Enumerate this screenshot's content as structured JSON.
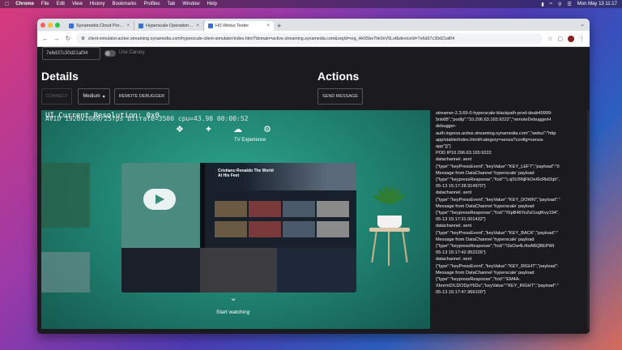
{
  "menubar": {
    "app": "Chrome",
    "items": [
      "File",
      "Edit",
      "View",
      "History",
      "Bookmarks",
      "Profiles",
      "Tab",
      "Window",
      "Help"
    ],
    "datetime": "Mon May 13  11:17"
  },
  "tabs": [
    {
      "label": "Synamedia Cloud Portal | Ho...",
      "active": false
    },
    {
      "label": "Hyperscale Operations UI",
      "active": false
    },
    {
      "label": "HS Webui Tester",
      "active": true
    }
  ],
  "address": {
    "url": "client-simulator.active.streaming.synamedia.com/hyperscale-client-simulator/index.html?domain=active.streaming.synamedia.com&orgId=org_Hk9Ske7hk0oV5Lof&deviceId=7e6d37c30d21af04"
  },
  "page": {
    "device_id": "7e6d37c30d21af04",
    "canary_label": "Use Canary",
    "details_heading": "Details",
    "actions_heading": "Actions",
    "connect_label": "CONNECT",
    "quality_value": "Medium",
    "remote_debugger_label": "REMOTE DEBUGGER",
    "send_message_label": "SEND MESSAGE"
  },
  "stream": {
    "osd_stats": "AVID 1920x1080/25fps bitrate=3500 cpu=43.98 00:00:52",
    "osd_resolution": "UI Current Resolution: 0x0",
    "tv_experience": "TV Experience",
    "start_watching": "Start watching",
    "hero_title": "Cristiano Ronaldo The World At His Feet"
  },
  "log_lines": [
    "streamer-2.3.69-0-hyperscale-blackpath-prod-deub49999-",
    "5nk6B\",\"podIp\":\"10.206.63.165:9222\",\"remoteDebuggerH",
    "debugger-",
    "auth.ingress.active.streaming.synamedia.com\",\"webui\":\"http",
    "app/stable/index.html#category=senza?config=senza-",
    "app\"}}\"}",
    "POD IP10.206.63.165:9222",
    "datachannel. sent",
    "{\"type\":\"keyPressEvent\",\"keyValue\":\"KEY_LEFT\",\"payload\":\"0",
    "Message from DataChannel 'hyperscale' payload",
    "{\"type\":\"keypressResponse\",\"fcid\":\"Lxj0U5NjFkOeI6cRkiDqh\",",
    "05-13 15:17:28.914970\"}",
    "datachannel. sent",
    "{\"type\":\"keyPressEvent\",\"keyValue\":\"KEY_DOWN\",\"payload\":\"",
    "Message from DataChannel 'hyperscale' payload",
    "{\"type\":\"keypressResponse\",\"fcid\":\"fXpB46YoZsI1sqIKvy194\",",
    "05-13 15:17:31.001432\"}",
    "datachannel. sent",
    "{\"type\":\"keyPressEvent\",\"keyValue\":\"KEY_BACK\",\"payload\":\"",
    "Message from DataChannel 'hyperscale' payload",
    "{\"type\":\"keypressResponse\",\"fcid\":\"l3sOw4LrltxABQBEPWt",
    "05-13 15:17:42.952226\"}",
    "datachannel. sent",
    "{\"type\":\"keyPressEvent\",\"keyValue\":\"KEY_RIGHT\",\"payload\":",
    "Message from DataChannel 'hyperscale' payload",
    "{\"type\":\"keypressResponse\",\"fcid\":\"EM4A-",
    "XbnrmDXJ2ODpY6Du\",\"keyValue\":\"KEY_RIGHT\",\"payload\":\"",
    "05-13 15:17:47.966100\"}"
  ]
}
